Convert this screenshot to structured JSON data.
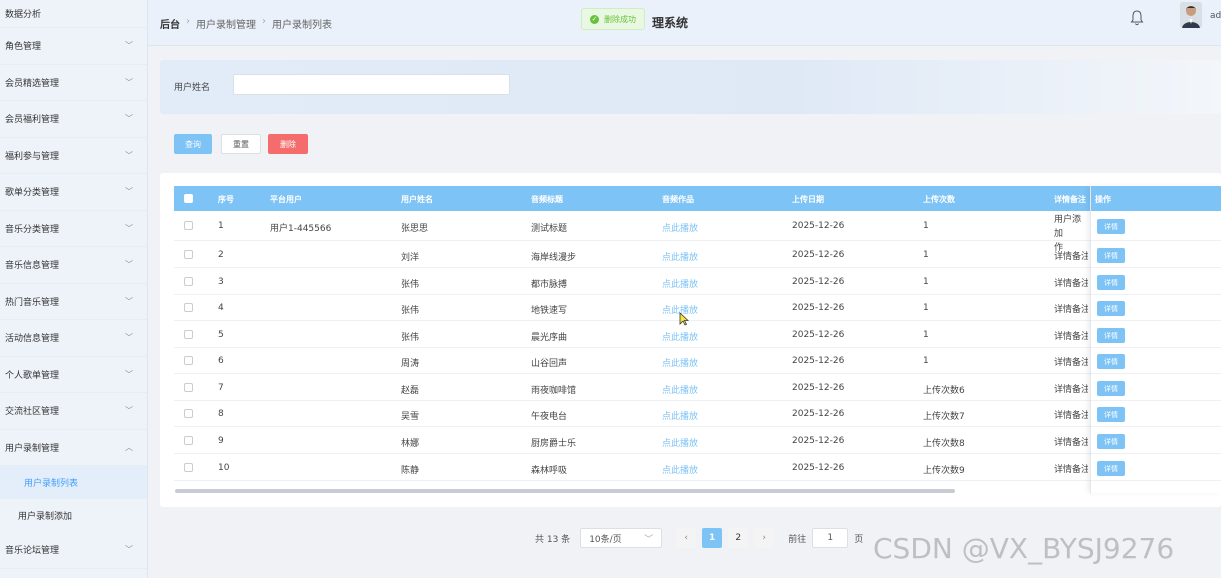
{
  "sidebar": {
    "top": "数据分析",
    "items": [
      {
        "label": "角色管理"
      },
      {
        "label": "会员精选管理"
      },
      {
        "label": "会员福利管理"
      },
      {
        "label": "福利参与管理"
      },
      {
        "label": "歌单分类管理"
      },
      {
        "label": "音乐分类管理"
      },
      {
        "label": "音乐信息管理"
      },
      {
        "label": "热门音乐管理"
      },
      {
        "label": "活动信息管理"
      },
      {
        "label": "个人歌单管理"
      },
      {
        "label": "交流社区管理"
      },
      {
        "label": "用户录制管理"
      }
    ],
    "sub": [
      "用户录制列表",
      "用户录制添加"
    ],
    "last": "音乐论坛管理"
  },
  "header": {
    "breadcrumb": [
      "后台",
      "用户录制管理",
      "用户录制列表"
    ],
    "toast": "删除成功",
    "title": "理系统",
    "user": "ad"
  },
  "search": {
    "label": "用户姓名",
    "value": ""
  },
  "buttons": {
    "query": "查询",
    "reset": "重置",
    "delete": "删除"
  },
  "table": {
    "columns": [
      "序号",
      "平台用户",
      "用户姓名",
      "音频标题",
      "音频作品",
      "上传日期",
      "上传次数",
      "详情备注",
      "操作"
    ],
    "rows": [
      {
        "idx": "1",
        "platform": "用户1-445566",
        "name": "张思思",
        "title": "测试标题",
        "work": "点此播放",
        "date": "2025-12-26",
        "count": "1",
        "note": "用户添加\n作"
      },
      {
        "idx": "2",
        "platform": "",
        "name": "刘洋",
        "title": "海岸线漫步",
        "work": "点此播放",
        "date": "2025-12-26",
        "count": "1",
        "note": "详情备注"
      },
      {
        "idx": "3",
        "platform": "",
        "name": "张伟",
        "title": "都市脉搏",
        "work": "点此播放",
        "date": "2025-12-26",
        "count": "1",
        "note": "详情备注"
      },
      {
        "idx": "4",
        "platform": "",
        "name": "张伟",
        "title": "地铁速写",
        "work": "点此播放",
        "date": "2025-12-26",
        "count": "1",
        "note": "详情备注"
      },
      {
        "idx": "5",
        "platform": "",
        "name": "张伟",
        "title": "晨光序曲",
        "work": "点此播放",
        "date": "2025-12-26",
        "count": "1",
        "note": "详情备注"
      },
      {
        "idx": "6",
        "platform": "",
        "name": "周涛",
        "title": "山谷回声",
        "work": "点此播放",
        "date": "2025-12-26",
        "count": "1",
        "note": "详情备注"
      },
      {
        "idx": "7",
        "platform": "",
        "name": "赵磊",
        "title": "雨夜咖啡馆",
        "work": "点此播放",
        "date": "2025-12-26",
        "count": "上传次数6",
        "note": "详情备注"
      },
      {
        "idx": "8",
        "platform": "",
        "name": "吴雪",
        "title": "午夜电台",
        "work": "点此播放",
        "date": "2025-12-26",
        "count": "上传次数7",
        "note": "详情备注"
      },
      {
        "idx": "9",
        "platform": "",
        "name": "林娜",
        "title": "厨房爵士乐",
        "work": "点此播放",
        "date": "2025-12-26",
        "count": "上传次数8",
        "note": "详情备注"
      },
      {
        "idx": "10",
        "platform": "",
        "name": "陈静",
        "title": "森林呼吸",
        "work": "点此播放",
        "date": "2025-12-26",
        "count": "上传次数9",
        "note": "详情备注"
      }
    ],
    "detail_label": "详情"
  },
  "pagination": {
    "total": "共 13 条",
    "size": "10条/页",
    "pages": [
      "1",
      "2"
    ],
    "goto": "前往",
    "page_value": "1",
    "page_unit": "页"
  },
  "watermark": "CSDN @VX_BYSJ9276",
  "colors": {
    "accent": "#7ec3f5",
    "danger": "#f56c6c",
    "success": "#67c23a"
  }
}
